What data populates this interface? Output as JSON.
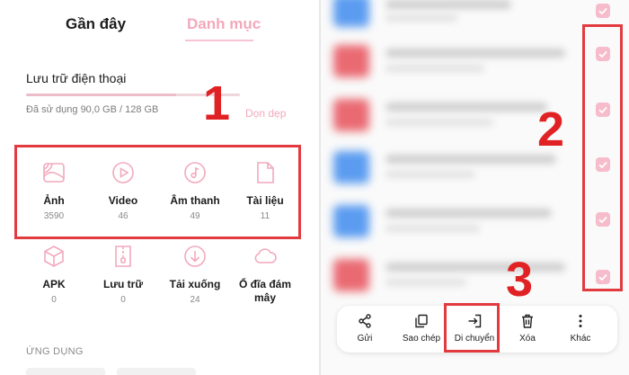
{
  "tabs": {
    "recent": "Gần đây",
    "category": "Danh mục"
  },
  "storage": {
    "title": "Lưu trữ điện thoại",
    "used_text": "Đã sử dụng 90,0 GB / 128 GB",
    "used_fraction": 0.7,
    "clean_label": "Dọn dẹp"
  },
  "categories": [
    {
      "name": "Ảnh",
      "count": "3590",
      "icon": "image-icon"
    },
    {
      "name": "Video",
      "count": "46",
      "icon": "video-icon"
    },
    {
      "name": "Âm thanh",
      "count": "49",
      "icon": "music-icon"
    },
    {
      "name": "Tài liệu",
      "count": "11",
      "icon": "document-icon"
    },
    {
      "name": "APK",
      "count": "0",
      "icon": "package-icon"
    },
    {
      "name": "Lưu trữ",
      "count": "0",
      "icon": "archive-icon"
    },
    {
      "name": "Tải xuống",
      "count": "24",
      "icon": "download-icon"
    },
    {
      "name": "Ổ đĩa đám mây",
      "count": "",
      "icon": "cloud-icon"
    }
  ],
  "apps_title": "ỨNG DỤNG",
  "annotations": {
    "step1": "1",
    "step2": "2",
    "step3": "3"
  },
  "toolbar": {
    "send": "Gửi",
    "copy": "Sao chép",
    "move": "Di chuyển",
    "delete": "Xóa",
    "more": "Khác"
  },
  "colors": {
    "accent_pink": "#f2a9bd",
    "annotation_red": "#e02225",
    "file_blue": "#5b9cf0",
    "file_red": "#ea6a72"
  }
}
